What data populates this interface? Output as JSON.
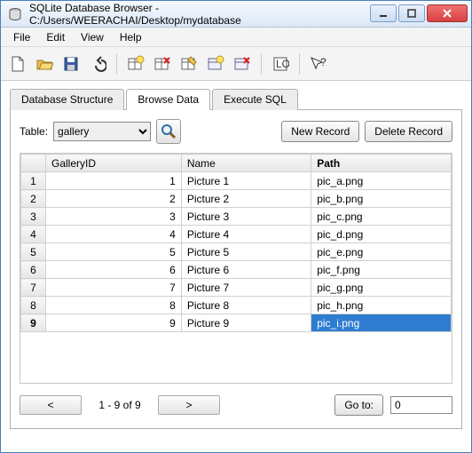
{
  "window": {
    "title": "SQLite Database Browser - C:/Users/WEERACHAI/Desktop/mydatabase"
  },
  "menu": {
    "file": "File",
    "edit": "Edit",
    "view": "View",
    "help": "Help"
  },
  "tabs": {
    "structure": "Database Structure",
    "browse": "Browse Data",
    "execute": "Execute SQL"
  },
  "browse": {
    "table_label": "Table:",
    "table_selected": "gallery",
    "new_record": "New Record",
    "delete_record": "Delete Record",
    "columns": {
      "rownum": "",
      "id": "GalleryID",
      "name": "Name",
      "path": "Path"
    },
    "rows": [
      {
        "n": "1",
        "id": "1",
        "name": "Picture 1",
        "path": "pic_a.png"
      },
      {
        "n": "2",
        "id": "2",
        "name": "Picture 2",
        "path": "pic_b.png"
      },
      {
        "n": "3",
        "id": "3",
        "name": "Picture 3",
        "path": "pic_c.png"
      },
      {
        "n": "4",
        "id": "4",
        "name": "Picture 4",
        "path": "pic_d.png"
      },
      {
        "n": "5",
        "id": "5",
        "name": "Picture 5",
        "path": "pic_e.png"
      },
      {
        "n": "6",
        "id": "6",
        "name": "Picture 6",
        "path": "pic_f.png"
      },
      {
        "n": "7",
        "id": "7",
        "name": "Picture 7",
        "path": "pic_g.png"
      },
      {
        "n": "8",
        "id": "8",
        "name": "Picture 8",
        "path": "pic_h.png"
      },
      {
        "n": "9",
        "id": "9",
        "name": "Picture 9",
        "path": "pic_i.png"
      }
    ],
    "selected_row_index": 8,
    "nav": {
      "prev": "<",
      "next": ">",
      "status": "1 - 9 of 9",
      "goto_label": "Go to:",
      "goto_value": "0"
    }
  }
}
